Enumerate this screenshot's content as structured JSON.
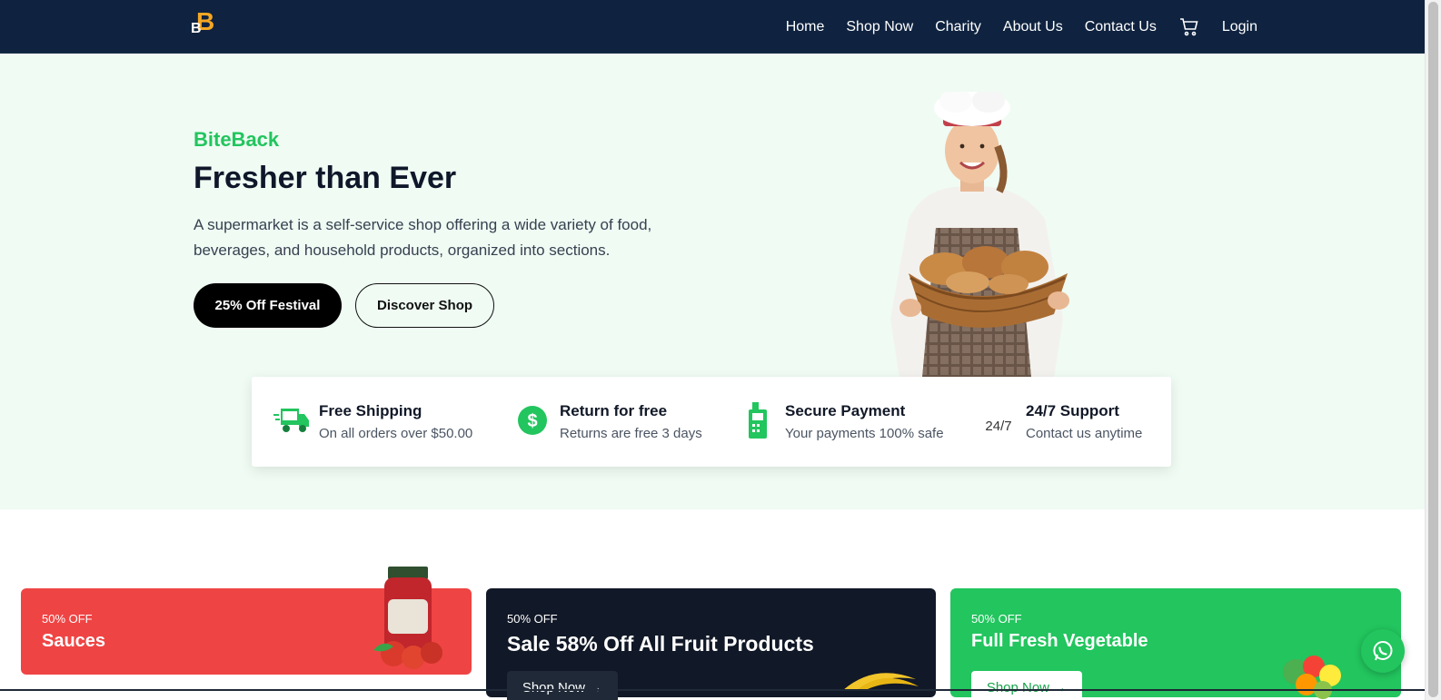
{
  "nav": {
    "logo_text": "BB",
    "links": [
      "Home",
      "Shop Now",
      "Charity",
      "About Us",
      "Contact Us"
    ],
    "login": "Login",
    "cart_icon": "cart-icon"
  },
  "hero": {
    "brand": "BiteBack",
    "headline": "Fresher than Ever",
    "description": "A supermarket is a self-service shop offering a wide variety of food, beverages, and household products, organized into sections.",
    "primary_button": "25% Off Festival",
    "secondary_button": "Discover Shop"
  },
  "features": [
    {
      "icon": "delivery-truck-icon",
      "title": "Free Shipping",
      "subtitle": "On all orders over $50.00"
    },
    {
      "icon": "dollar-icon",
      "title": "Return for free",
      "subtitle": "Returns are free 3 days"
    },
    {
      "icon": "payment-terminal-icon",
      "title": "Secure Payment",
      "subtitle": "Your payments 100% safe"
    },
    {
      "icon_alt": "24/7",
      "title": "24/7 Support",
      "subtitle": "Contact us anytime"
    }
  ],
  "promos": [
    {
      "tag": "50% OFF",
      "title": "Sauces"
    },
    {
      "tag": "50% OFF",
      "title": "Sale 58% Off All Fruit Products",
      "button": "Shop Now →"
    },
    {
      "tag": "50% OFF",
      "title": "Full Fresh Vegetable",
      "button": "Shop Now →"
    }
  ],
  "colors": {
    "navbar": "#0f2340",
    "accent": "#22c55e",
    "hero_bg": "#effbf3",
    "sauce_card": "#ef4444",
    "fruit_card": "#111827",
    "veg_card": "#22c55e"
  }
}
